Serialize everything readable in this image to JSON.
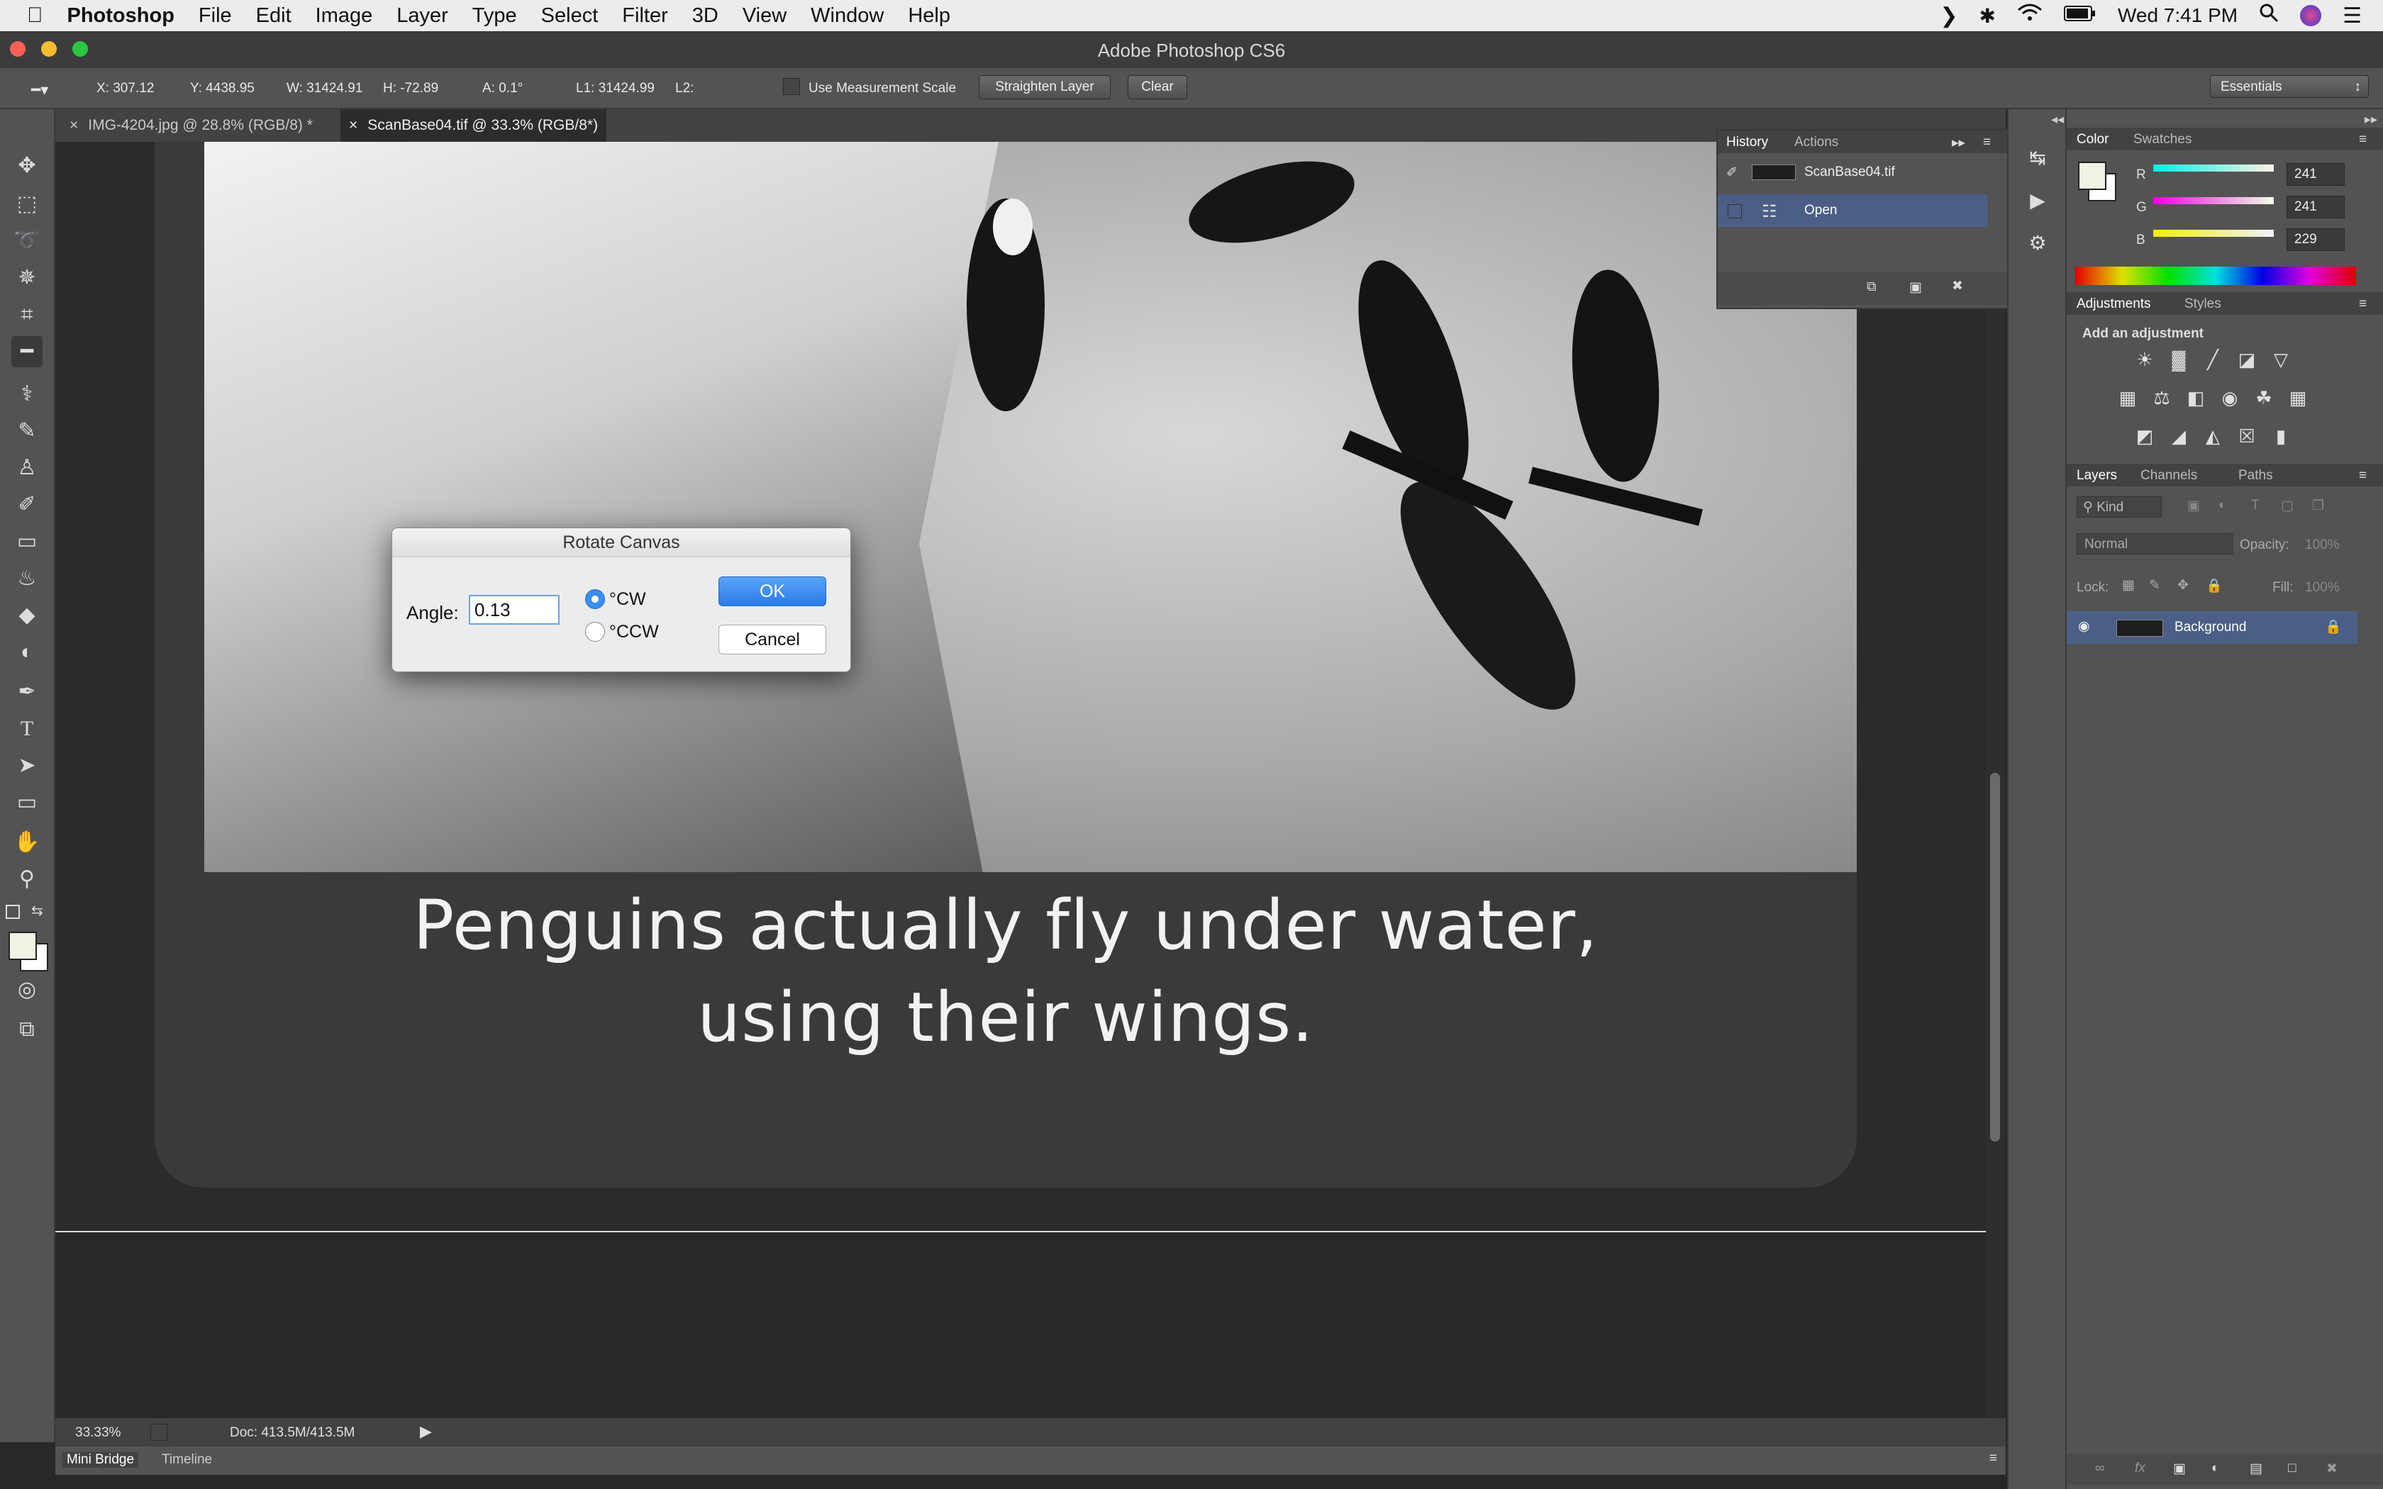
{
  "menubar": {
    "apple": "",
    "app": "Photoshop",
    "items": [
      "File",
      "Edit",
      "Image",
      "Layer",
      "Type",
      "Select",
      "Filter",
      "3D",
      "View",
      "Window",
      "Help"
    ],
    "clock": "Wed 7:41 PM",
    "icons": [
      "chevron-right-icon",
      "bluetooth-icon",
      "wifi-icon",
      "battery-icon",
      "search-icon",
      "siri-icon",
      "list-icon"
    ]
  },
  "window": {
    "title": "Adobe Photoshop CS6"
  },
  "options": {
    "x": "X: 307.12",
    "y": "Y: 4438.95",
    "w": "W: 31424.91",
    "h": "H: -72.89",
    "a": "A: 0.1°",
    "l1": "L1: 31424.99",
    "l2": "L2:",
    "use_measurement_scale": "Use Measurement Scale",
    "straighten_layer": "Straighten Layer",
    "clear": "Clear",
    "workspace": "Essentials"
  },
  "tabs": [
    {
      "label": "IMG-4204.jpg @ 28.8% (RGB/8) *"
    },
    {
      "label": "ScanBase04.tif @ 33.3% (RGB/8*)"
    }
  ],
  "document": {
    "caption_line1": "Penguins actually fly under water,",
    "caption_line2": "using  their  wings."
  },
  "status": {
    "zoom": "33.33%",
    "doc": "Doc: 413.5M/413.5M"
  },
  "bottom_tabs": {
    "mini_bridge": "Mini Bridge",
    "timeline": "Timeline"
  },
  "history": {
    "tab_history": "History",
    "tab_actions": "Actions",
    "snapshot": "ScanBase04.tif",
    "state_open": "Open"
  },
  "color_panel": {
    "tab_color": "Color",
    "tab_swatches": "Swatches",
    "r_label": "R",
    "r_value": "241",
    "g_label": "G",
    "g_value": "241",
    "b_label": "B",
    "b_value": "229",
    "foreground": "#f1f1e5"
  },
  "adjustments": {
    "tab_adjustments": "Adjustments",
    "tab_styles": "Styles",
    "add": "Add an adjustment"
  },
  "layers": {
    "tab_layers": "Layers",
    "tab_channels": "Channels",
    "tab_paths": "Paths",
    "kind": "Kind",
    "blend_mode": "Normal",
    "opacity_label": "Opacity:",
    "opacity_value": "100%",
    "lock_label": "Lock:",
    "fill_label": "Fill:",
    "fill_value": "100%",
    "layer_name": "Background"
  },
  "dialog": {
    "title": "Rotate Canvas",
    "angle_label": "Angle:",
    "angle_value": "0.13",
    "cw": "°CW",
    "ccw": "°CCW",
    "ok": "OK",
    "cancel": "Cancel"
  },
  "colors": {
    "accent": "#3b8ef0",
    "selection": "#4b5f86"
  }
}
